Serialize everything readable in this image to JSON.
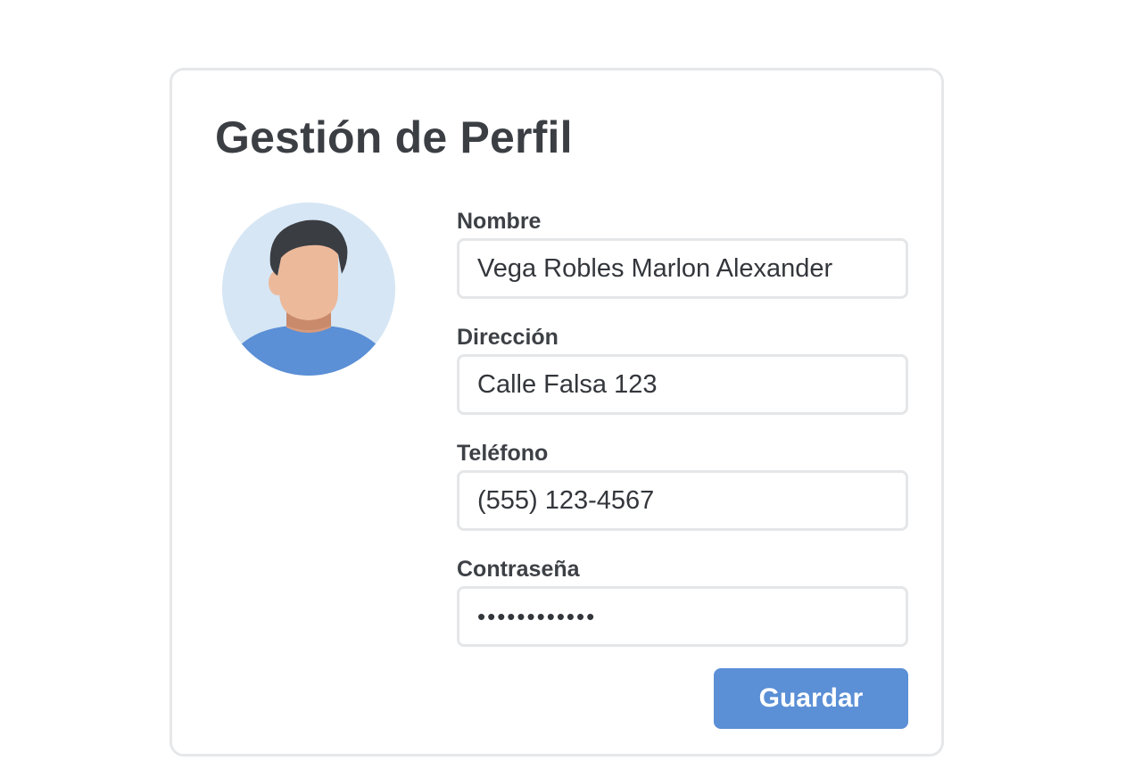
{
  "profile": {
    "title": "Gestión de Perfil",
    "avatar_icon": "user-avatar-icon",
    "fields": {
      "name": {
        "label": "Nombre",
        "value": "Vega Robles Marlon Alexander"
      },
      "address": {
        "label": "Dirección",
        "value": "Calle Falsa 123"
      },
      "phone": {
        "label": "Teléfono",
        "value": "(555) 123-4567"
      },
      "password": {
        "label": "Contraseña",
        "value": "aaaaaaaaaaaa"
      }
    },
    "save_label": "Guardar"
  },
  "colors": {
    "accent": "#5b8fd6",
    "avatar_bg": "#d6e6f4",
    "skin": "#ecb99b",
    "hair": "#3a3d42",
    "shirt": "#5b8fd6",
    "border": "#e6e7e9"
  }
}
